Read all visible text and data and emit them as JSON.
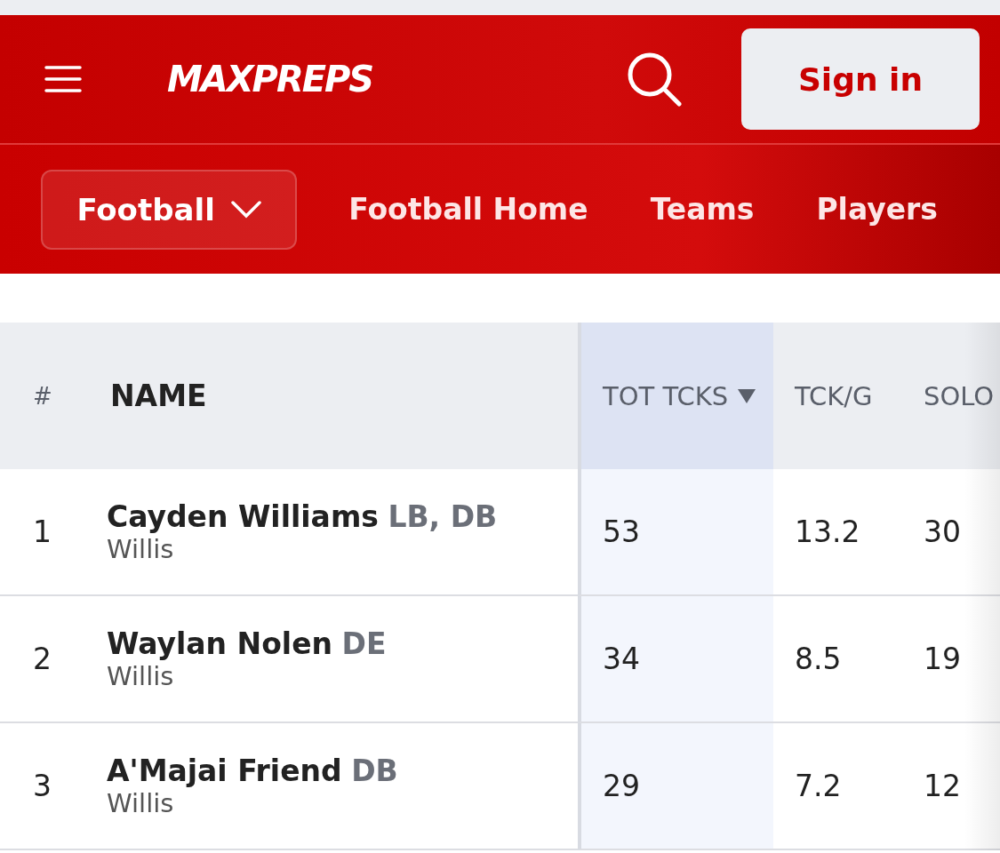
{
  "header": {
    "logo": "MAXPREPS",
    "sign_in": "Sign in"
  },
  "nav": {
    "sport": {
      "label": "Football",
      "expanded": false
    },
    "links": [
      "Football Home",
      "Teams",
      "Players"
    ]
  },
  "table": {
    "columns": [
      {
        "label": "#",
        "sorted": false
      },
      {
        "label": "NAME",
        "sorted": false
      },
      {
        "label": "TOT TCKS",
        "sorted": true
      },
      {
        "label": "TCK/G",
        "sorted": false
      },
      {
        "label": "SOLO",
        "sorted": false
      }
    ],
    "rows": [
      {
        "rank": "1",
        "name": "Cayden Williams",
        "positions": "LB, DB",
        "school": "Willis",
        "values": [
          "53",
          "13.2",
          "30"
        ]
      },
      {
        "rank": "2",
        "name": "Waylan Nolen",
        "positions": "DE",
        "school": "Willis",
        "values": [
          "34",
          "8.5",
          "19"
        ]
      },
      {
        "rank": "3",
        "name": "A'Majai Friend",
        "positions": "DB",
        "school": "Willis",
        "values": [
          "29",
          "7.2",
          "12"
        ]
      }
    ]
  }
}
